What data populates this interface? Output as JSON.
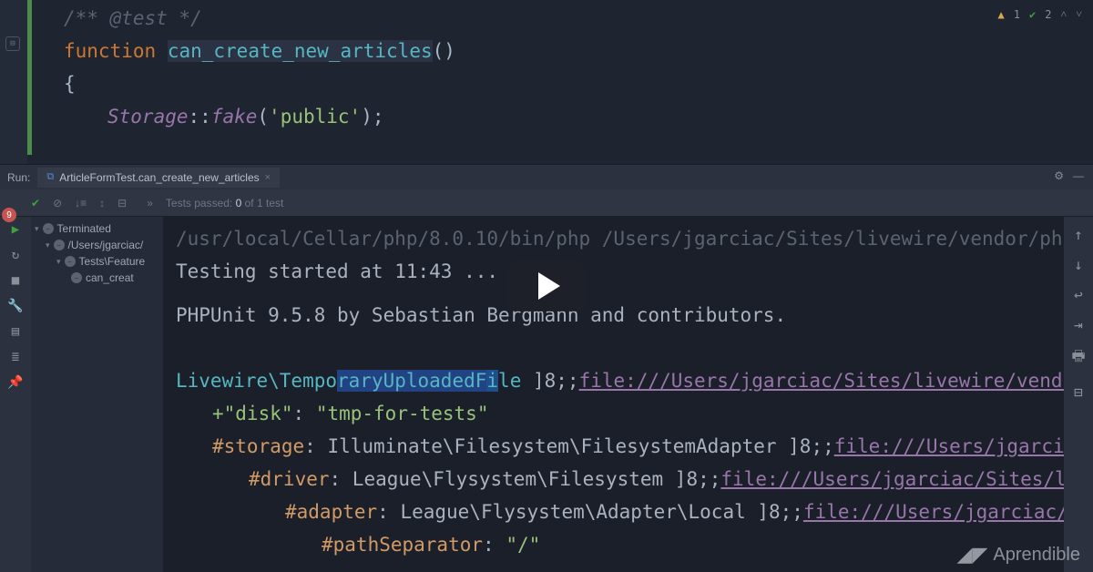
{
  "inspections": {
    "warnings": "1",
    "checks": "2"
  },
  "code": {
    "comment": "/** @test */",
    "keyword": "function",
    "fn_name": "can_create_new_articles",
    "parens": "()",
    "brace_open": "{",
    "call_class": "Storage",
    "call_sep": "::",
    "call_method": "fake",
    "call_open": "(",
    "call_arg": "'public'",
    "call_close": ");"
  },
  "run": {
    "label": "Run:",
    "tab": "ArticleFormTest.can_create_new_articles",
    "passed_prefix": "Tests passed: ",
    "passed_count": "0",
    "passed_suffix": " of 1 test"
  },
  "tree": {
    "root": "Terminated",
    "node1": "/Users/jgarciac/",
    "node2": "Tests\\Feature",
    "leaf": "can_creat"
  },
  "console": {
    "path_fade": "/usr/local/Cellar/php/8.0.10/bin/php /Users/jgarciac/Sites/livewire/vendor/ph",
    "started": "Testing started at 11:43 ...",
    "phpunit": "PHPUnit 9.5.8 by Sebastian Bergmann and contributors.",
    "l1_cls": "Livewire\\TemporaryUploadedFile",
    "l1_sep": " ]8;;",
    "l1_link": "file:///Users/jgarciac/Sites/livewire/vendo",
    "disk_key": "+\"disk\"",
    "disk_sep": ": ",
    "disk_val": "\"tmp-for-tests\"",
    "storage_hash": "#storage",
    "storage_rest": ": Illuminate\\Filesystem\\FilesystemAdapter ]8;;",
    "storage_link": "file:///Users/jgarciac",
    "driver_hash": "#driver",
    "driver_rest": ": League\\Flysystem\\Filesystem ]8;;",
    "driver_link": "file:///Users/jgarciac/Sites/live",
    "adapter_hash": "#adapter",
    "adapter_rest": ": League\\Flysystem\\Adapter\\Local ]8;;",
    "adapter_link": "file:///Users/jgarciac/Site",
    "pathsep_hash": "#pathSeparator",
    "pathsep_sep": ": ",
    "pathsep_val": "\"/\""
  },
  "watermark": "Aprendible",
  "badge": "9"
}
